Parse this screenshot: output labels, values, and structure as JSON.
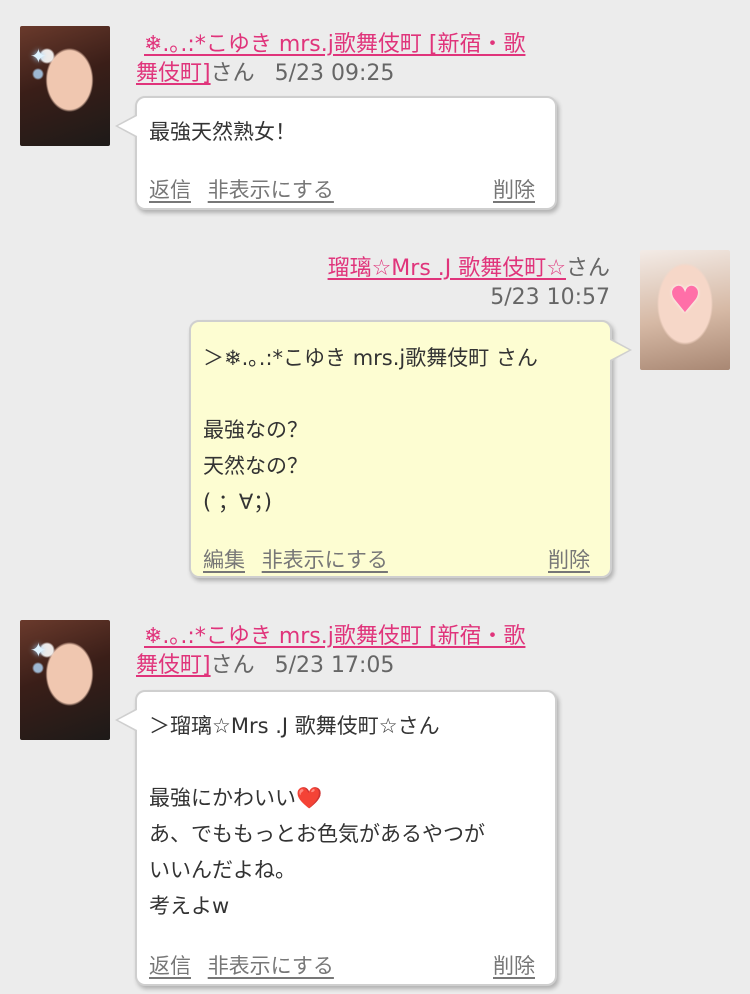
{
  "messages": [
    {
      "name": "❄.｡.:*こゆき mrs.j歌舞伎町 [新宿・歌",
      "name2": "舞伎町]",
      "suffix": "さん",
      "date": "5/23 09:25",
      "body": "最強天然熟女！",
      "actions": {
        "reply": "返信",
        "hide": "非表示にする",
        "delete": "削除"
      }
    },
    {
      "name": "瑠璃☆Mrs .J 歌舞伎町☆",
      "suffix": "さん",
      "date": "5/23 10:57",
      "body": "＞❄.｡.:*こゆき mrs.j歌舞伎町 さん\n\n最強なの？\n天然なの？\n(  ；∀；)",
      "actions": {
        "edit": "編集",
        "hide": "非表示にする",
        "delete": "削除"
      }
    },
    {
      "name": "❄.｡.:*こゆき mrs.j歌舞伎町 [新宿・歌",
      "name2": "舞伎町]",
      "suffix": "さん",
      "date": "5/23 17:05",
      "body": "＞瑠璃☆Mrs .J 歌舞伎町☆さん\n\n最強にかわいい❤️\nあ、でももっとお色気があるやつが\nいいんだよね。\n考えよw",
      "actions": {
        "reply": "返信",
        "hide": "非表示にする",
        "delete": "削除"
      }
    }
  ],
  "colors": {
    "accent": "#e0347b",
    "bg": "#ececec",
    "self_bubble": "#fdfdd2",
    "other_bubble": "#ffffff"
  },
  "icons": {
    "heart": "heart-sticker-icon",
    "sparkle": "sparkle-icon"
  }
}
